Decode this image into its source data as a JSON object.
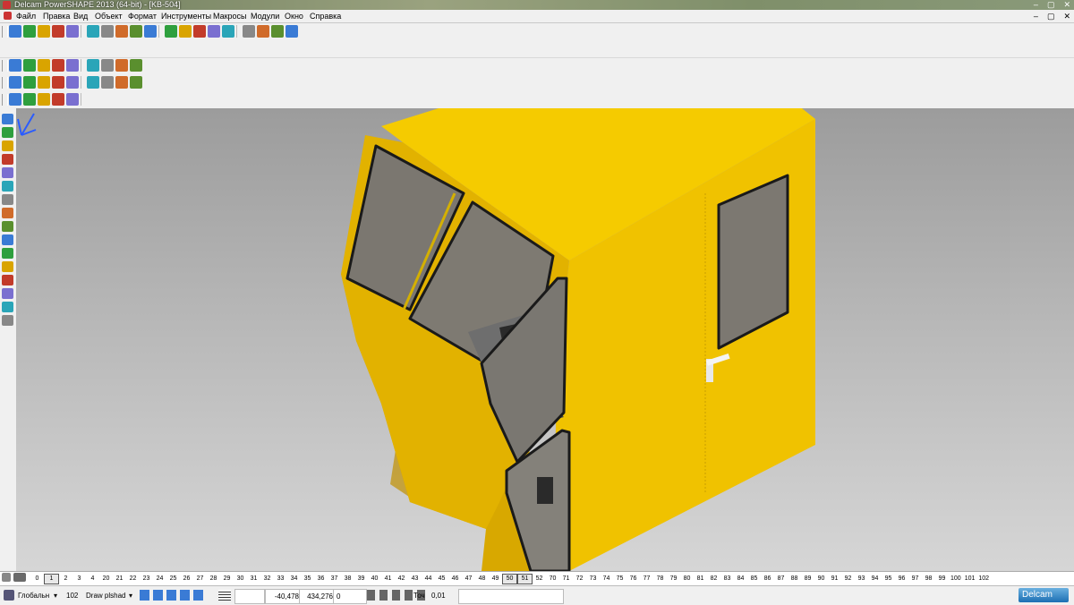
{
  "window": {
    "title": "Delcam PowerSHAPE 2013 (64-bit) - [KB-504]",
    "controls": [
      "–",
      "▢",
      "✕"
    ]
  },
  "menu": {
    "items": [
      "Файл",
      "Правка",
      "Вид",
      "Объект",
      "Формат",
      "Инструменты",
      "Макросы",
      "Модули",
      "Окно",
      "Справка"
    ],
    "doc_controls": [
      "–",
      "▢",
      "✕"
    ]
  },
  "levels": {
    "numbers": [
      "0",
      "1",
      "2",
      "3",
      "4",
      "20",
      "21",
      "22",
      "23",
      "24",
      "25",
      "26",
      "27",
      "28",
      "29",
      "30",
      "31",
      "32",
      "33",
      "34",
      "35",
      "36",
      "37",
      "38",
      "39",
      "40",
      "41",
      "42",
      "43",
      "44",
      "45",
      "46",
      "47",
      "48",
      "49",
      "50",
      "51",
      "52",
      "70",
      "71",
      "72",
      "73",
      "74",
      "75",
      "76",
      "77",
      "78",
      "79",
      "80",
      "81",
      "82",
      "83",
      "84",
      "85",
      "86",
      "87",
      "88",
      "89",
      "90",
      "91",
      "92",
      "93",
      "94",
      "95",
      "96",
      "97",
      "98",
      "99",
      "100",
      "101",
      "102"
    ],
    "active": [
      "1",
      "50",
      "51"
    ]
  },
  "status": {
    "workplane": "Глобальн",
    "level_number": "102",
    "level_name": "Draw plshad",
    "x": "-40,478",
    "y": "434,276",
    "z": "0",
    "tolerance_label": "Точ",
    "tolerance_value": "0,01",
    "brand": "Delcam"
  },
  "colors": {
    "cab_yellow": "#f2c400",
    "glass": "#7a7872",
    "viewport_top": "#9c9c9c",
    "brand_blue": "#1c6fb3"
  },
  "toolbars": {
    "row1_icons": [
      "new-icon",
      "open-icon",
      "save-icon",
      "print-icon",
      "cut-icon",
      "copy-icon",
      "paste-icon",
      "undo-icon",
      "redo-icon",
      "select-icon",
      "line-icon",
      "arc-icon",
      "curve-icon",
      "text-icon",
      "surface-icon",
      "solid-icon",
      "shade-icon",
      "wireframe-icon",
      "zoom-icon"
    ],
    "row2_icons": [
      "view-top-icon",
      "view-front-icon",
      "view-iso-icon",
      "shade-smooth-icon",
      "render-icon",
      "light-icon",
      "material-icon",
      "layer-icon",
      "hide-icon"
    ],
    "row3_icons": [
      "solid-box-icon",
      "solid-cyl-icon",
      "solid-sphere-icon",
      "boolean-add-icon",
      "boolean-sub-icon",
      "extrude-icon",
      "revolve-icon",
      "fillet-icon",
      "chamfer-icon"
    ],
    "row4_icons": [
      "wf-icon",
      "dim-icon",
      "measure-icon",
      "check-icon",
      "analysis-icon"
    ]
  }
}
